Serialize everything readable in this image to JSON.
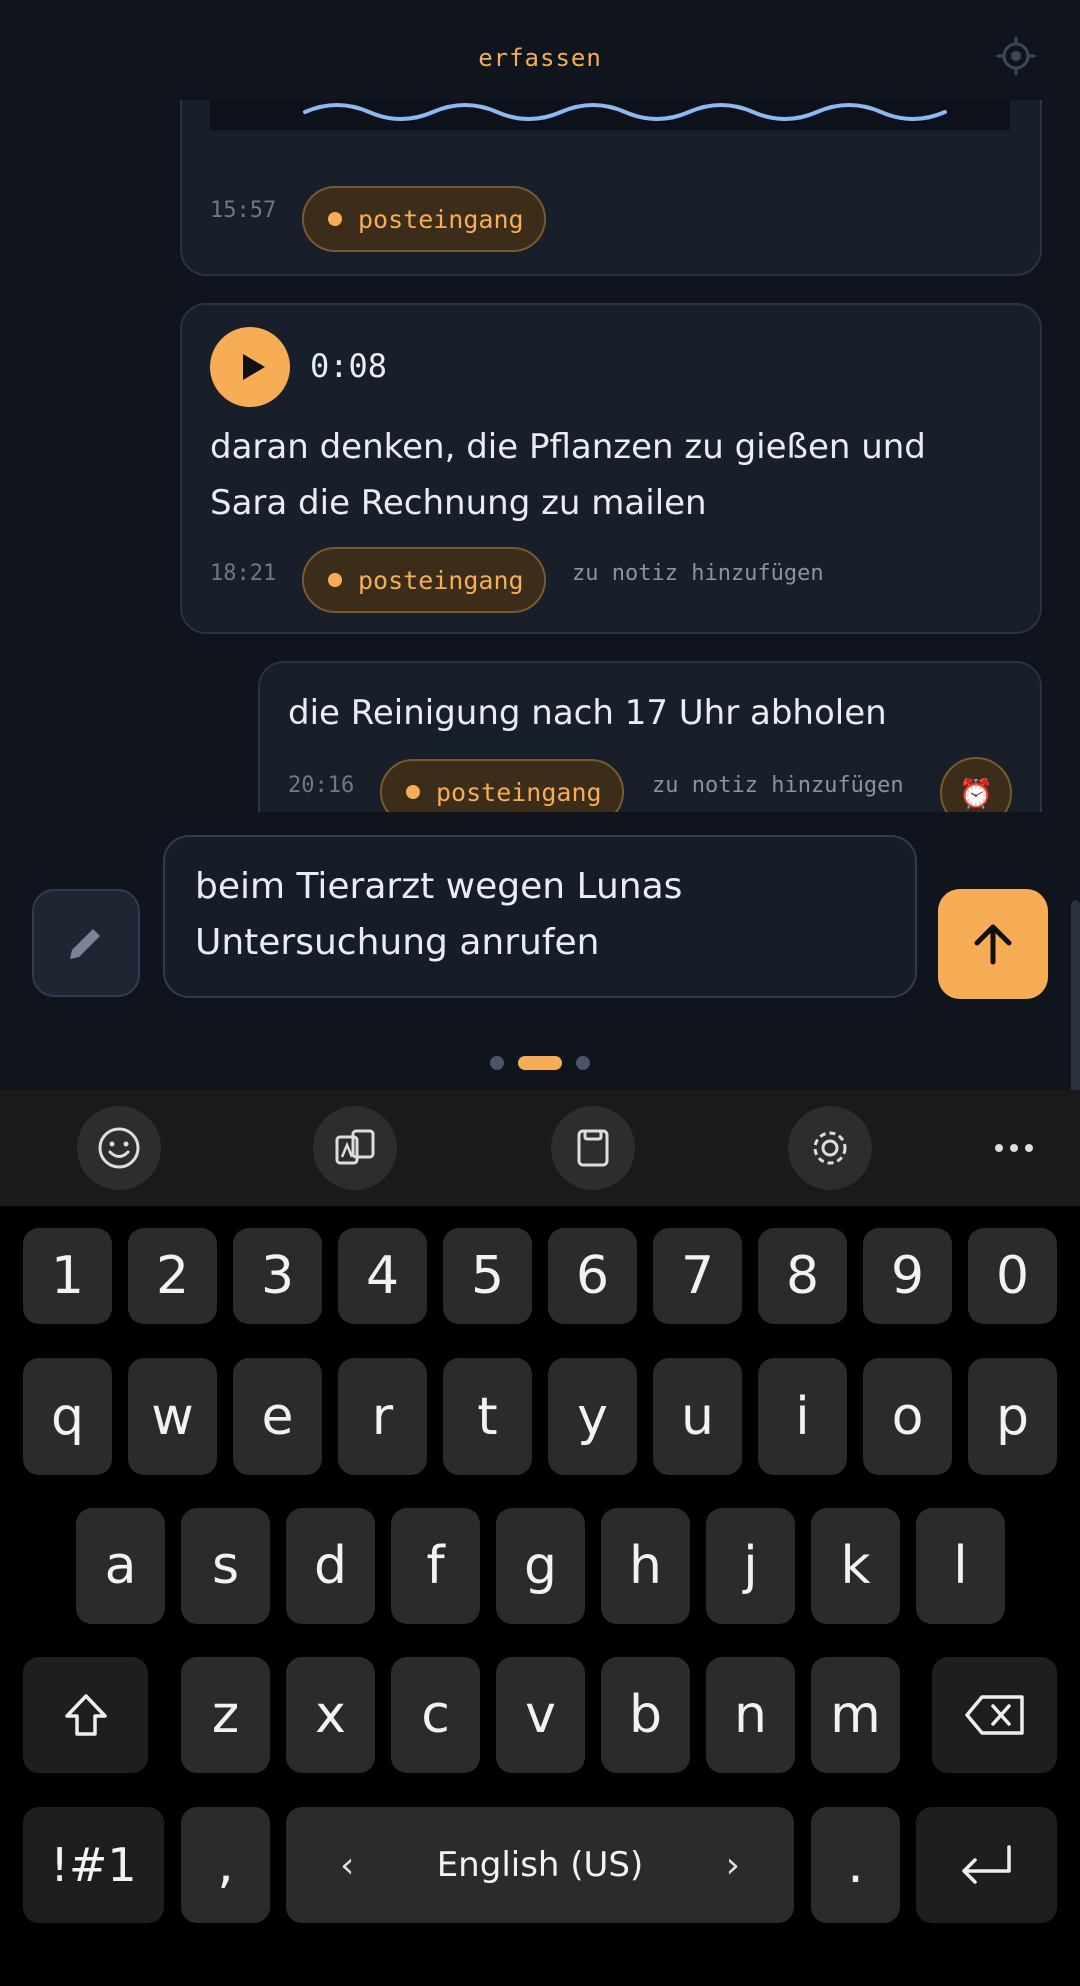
{
  "header": {
    "title": "erfassen",
    "settings_icon": "sun-settings-icon"
  },
  "feed": {
    "items": [
      {
        "time": "15:57",
        "tag": "posteingang"
      },
      {
        "duration": "0:08",
        "text": "daran denken, die Pflanzen zu gießen und Sara die Rechnung zu mailen",
        "time": "18:21",
        "tag": "posteingang",
        "add_note": "zu notiz hinzufügen"
      },
      {
        "text": "die Reinigung nach 17 Uhr abholen",
        "time": "20:16",
        "tag": "posteingang",
        "add_note": "zu notiz hinzufügen",
        "alarm_icon": "⏰"
      }
    ]
  },
  "compose": {
    "value": "beim Tierarzt wegen Lunas Untersuchung anrufen"
  },
  "pager": {
    "count": 3,
    "active": 1
  },
  "colors": {
    "accent": "#f6ad55",
    "background": "#0f141d",
    "card": "#181e2a",
    "keyboard": "#000000",
    "key": "#2b2b2b"
  },
  "keyboard": {
    "toolbar": [
      "emoji-icon",
      "translate-icon",
      "clipboard-icon",
      "settings-icon",
      "more-icon"
    ],
    "numbers": [
      "1",
      "2",
      "3",
      "4",
      "5",
      "6",
      "7",
      "8",
      "9",
      "0"
    ],
    "row1": [
      "q",
      "w",
      "e",
      "r",
      "t",
      "y",
      "u",
      "i",
      "o",
      "p"
    ],
    "row2": [
      "a",
      "s",
      "d",
      "f",
      "g",
      "h",
      "j",
      "k",
      "l"
    ],
    "row3": [
      "z",
      "x",
      "c",
      "v",
      "b",
      "n",
      "m"
    ],
    "symbols": "!#1",
    "comma": ",",
    "space_label": "English (US)",
    "period": "."
  }
}
